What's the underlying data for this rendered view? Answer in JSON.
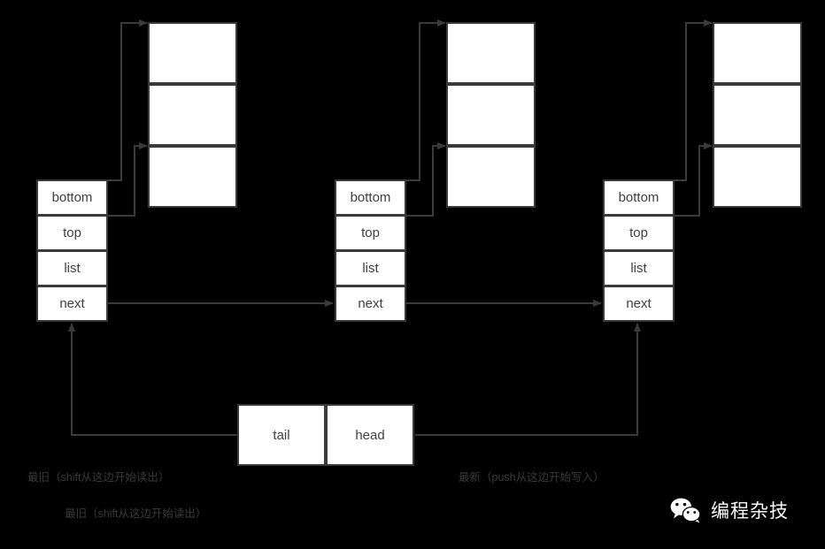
{
  "diagram": {
    "title": "linked-list-of-array-blocks-deque",
    "background_color": "#000000",
    "box_fill": "#ffffff",
    "box_border_color": "#3a3a3a",
    "text_color": "#3f3f3f",
    "line_color": "#3a3a3a",
    "nodes": [
      {
        "id": "node-1",
        "fields": [
          {
            "label": "bottom"
          },
          {
            "label": "top"
          },
          {
            "label": "list"
          },
          {
            "label": "next"
          }
        ],
        "array_slots": [
          {
            "label": ""
          },
          {
            "label": ""
          },
          {
            "label": ""
          }
        ]
      },
      {
        "id": "node-2",
        "fields": [
          {
            "label": "bottom"
          },
          {
            "label": "top"
          },
          {
            "label": "list"
          },
          {
            "label": "next"
          }
        ],
        "array_slots": [
          {
            "label": ""
          },
          {
            "label": ""
          },
          {
            "label": ""
          }
        ]
      },
      {
        "id": "node-3",
        "fields": [
          {
            "label": "bottom"
          },
          {
            "label": "top"
          },
          {
            "label": "list"
          },
          {
            "label": "next"
          }
        ],
        "array_slots": [
          {
            "label": ""
          },
          {
            "label": ""
          },
          {
            "label": ""
          }
        ]
      }
    ],
    "pointers": {
      "tail_label": "tail",
      "head_label": "head"
    },
    "captions": [
      {
        "id": "caption-oldest-1",
        "text": "最旧（shift从这边开始读出）"
      },
      {
        "id": "caption-oldest-2",
        "text": "最旧（shift从这边开始读出）"
      },
      {
        "id": "caption-newest",
        "text": "最新（push从这边开始写入）"
      }
    ]
  },
  "watermark": {
    "icon": "wechat-icon",
    "text": "编程杂技",
    "color": "#ffffff"
  }
}
